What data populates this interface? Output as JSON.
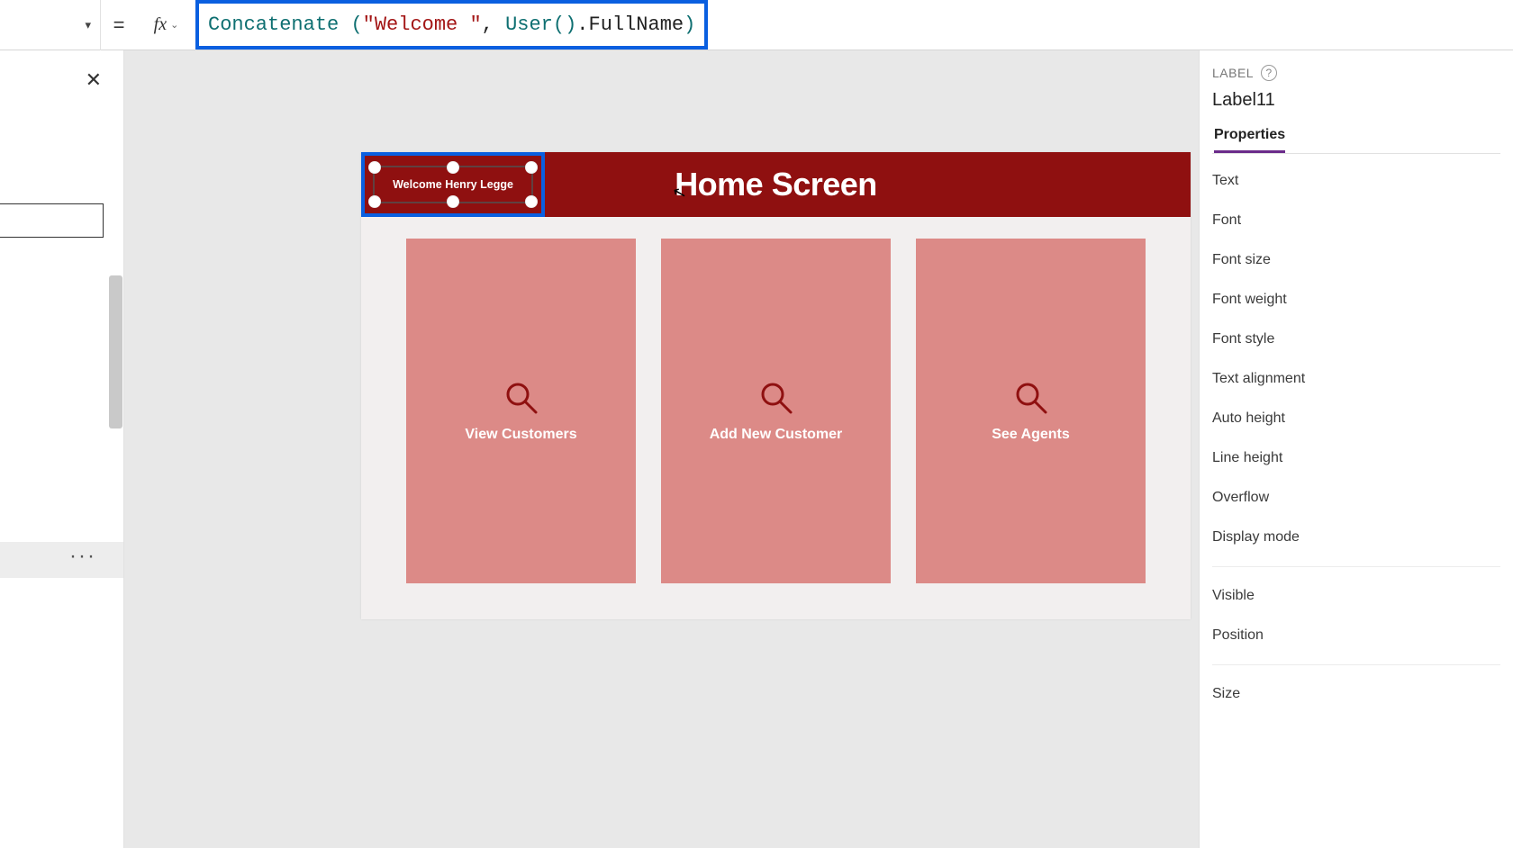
{
  "formulaBar": {
    "equals": "=",
    "fx": "fx",
    "tok_func": "Concatenate ",
    "tok_open": "(",
    "tok_str": "\"Welcome \"",
    "tok_comma": ", ",
    "tok_user": "User",
    "tok_userp": "()",
    "tok_dot": ".FullName",
    "tok_close": ")"
  },
  "leftPanel": {
    "more": "···"
  },
  "canvas": {
    "header_title": "Home Screen",
    "welcome_label": "Welcome Henry Legge",
    "cards": [
      {
        "label": "View Customers"
      },
      {
        "label": "Add New Customer"
      },
      {
        "label": "See Agents"
      }
    ]
  },
  "properties": {
    "heading": "LABEL",
    "help": "?",
    "control_name": "Label11",
    "tab": "Properties",
    "rows": [
      "Text",
      "Font",
      "Font size",
      "Font weight",
      "Font style",
      "Text alignment",
      "Auto height",
      "Line height",
      "Overflow",
      "Display mode"
    ],
    "rows2": [
      "Visible",
      "Position"
    ],
    "rows3": [
      "Size"
    ]
  }
}
